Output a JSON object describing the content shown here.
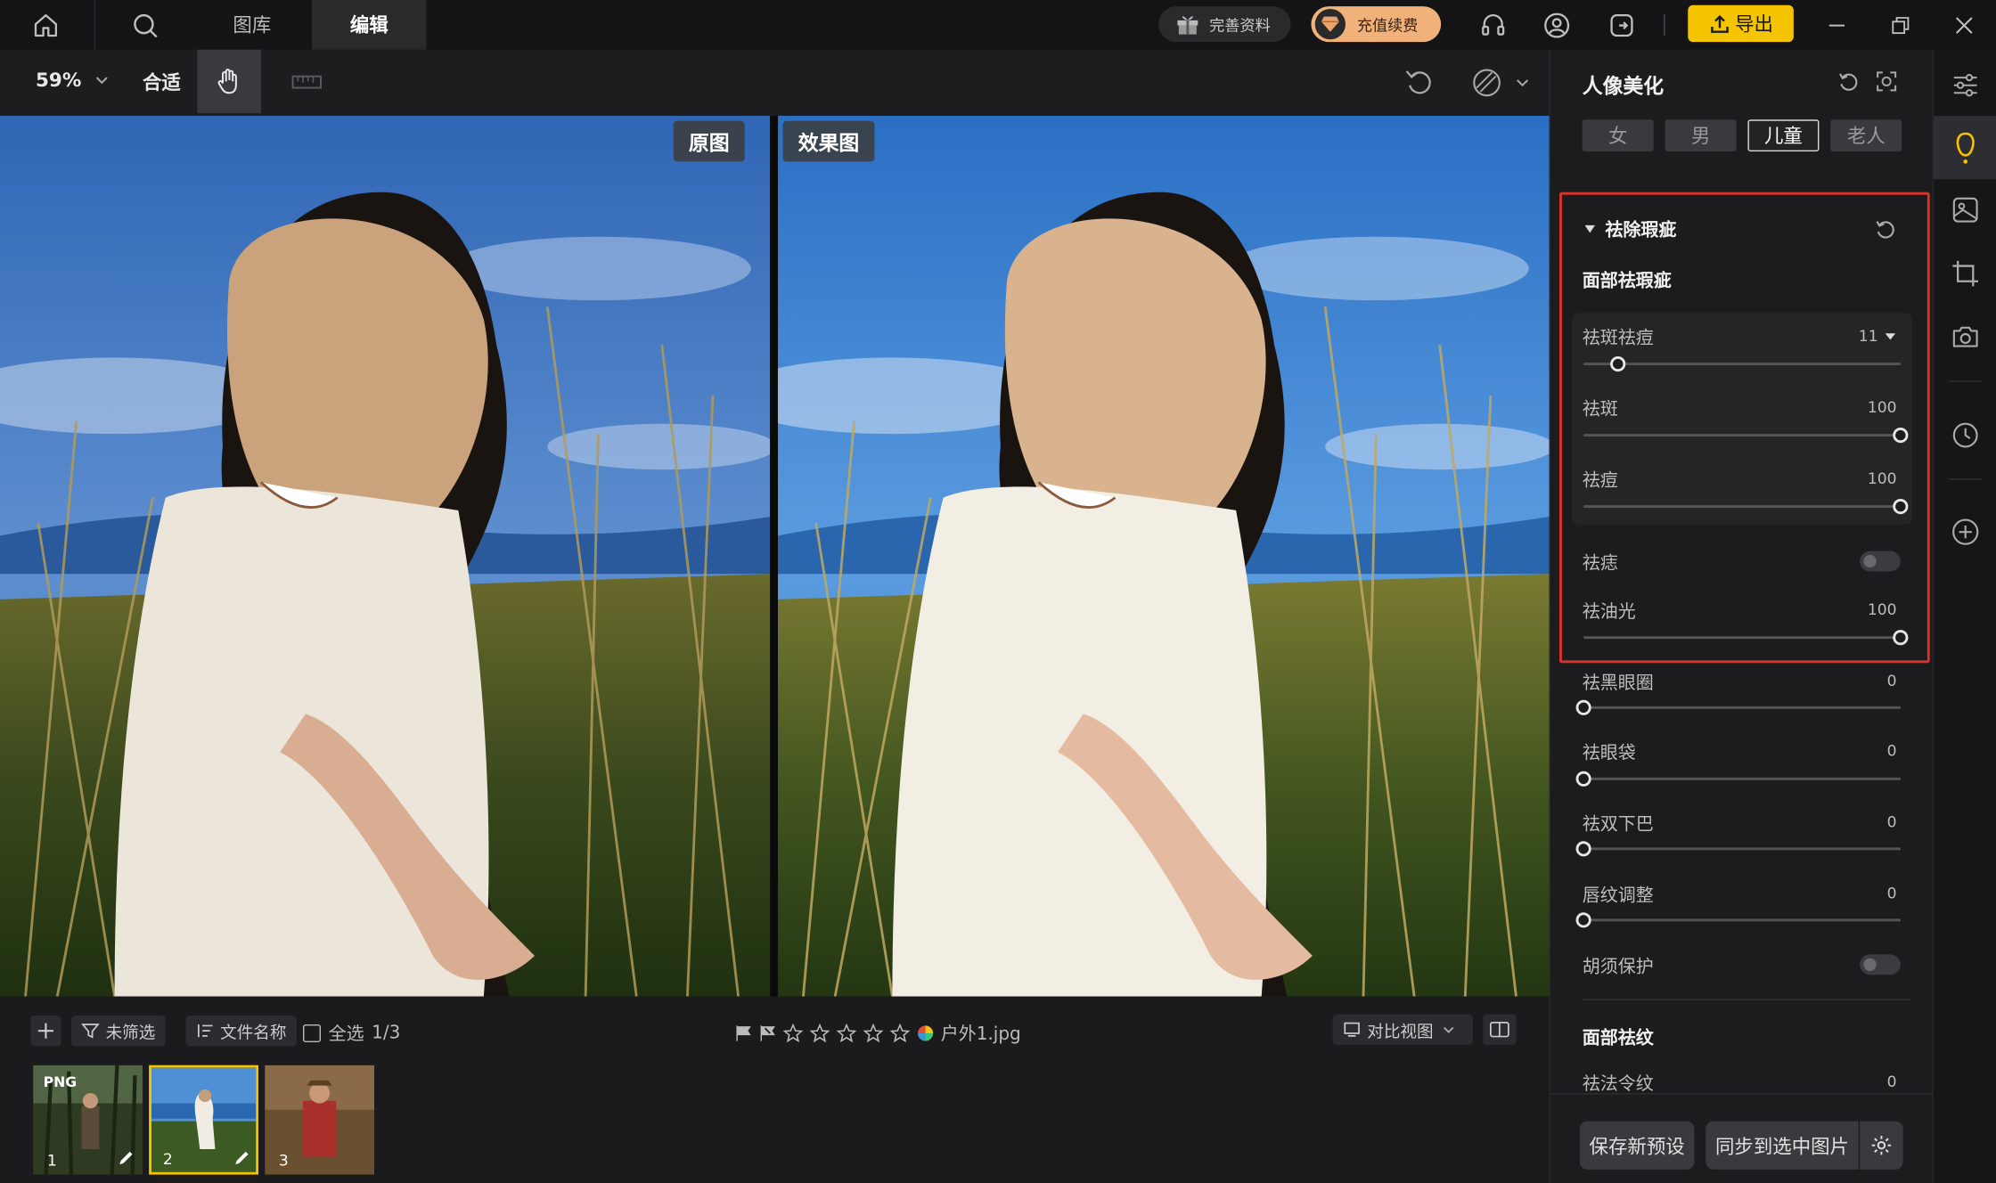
{
  "topbar": {
    "tabs": [
      "图库",
      "编辑"
    ],
    "profile_btn": "完善资料",
    "recharge_btn": "充值续费",
    "export_btn": "导出"
  },
  "toolbar": {
    "zoom": "59%",
    "fit": "合适"
  },
  "preview": {
    "original_label": "原图",
    "effect_label": "效果图"
  },
  "bottom": {
    "filter": "未筛选",
    "sort": "文件名称",
    "select_all": "全选",
    "count": "1/3",
    "filename": "户外1.jpg",
    "view_mode": "对比视图",
    "thumbs": [
      {
        "num": "1",
        "badge": "PNG"
      },
      {
        "num": "2",
        "badge": ""
      },
      {
        "num": "3",
        "badge": ""
      }
    ]
  },
  "panel": {
    "title": "人像美化",
    "segments": [
      "女",
      "男",
      "儿童",
      "老人"
    ],
    "active_segment": "儿童",
    "section": "祛除瑕疵",
    "subsection": "面部祛瑕疵",
    "sliders": {
      "spot_acne": {
        "label": "祛斑祛痘",
        "value": "11",
        "fraction": 0.11
      },
      "spot": {
        "label": "祛斑",
        "value": "100",
        "fraction": 1.0
      },
      "acne": {
        "label": "祛痘",
        "value": "100",
        "fraction": 1.0
      },
      "oil": {
        "label": "祛油光",
        "value": "100",
        "fraction": 1.0
      },
      "dark_circle": {
        "label": "祛黑眼圈",
        "value": "0",
        "fraction": 0
      },
      "eye_bag": {
        "label": "祛眼袋",
        "value": "0",
        "fraction": 0
      },
      "double_chin": {
        "label": "祛双下巴",
        "value": "0",
        "fraction": 0
      },
      "lip_line": {
        "label": "唇纹调整",
        "value": "0",
        "fraction": 0
      },
      "nasolabial": {
        "label": "祛法令纹",
        "value": "0",
        "fraction": 0
      }
    },
    "mole": {
      "label": "祛痣",
      "on": false
    },
    "beard": {
      "label": "胡须保护",
      "on": false
    },
    "wrinkle_section": "面部祛纹",
    "save_preset": "保存新预设",
    "sync": "同步到选中图片"
  },
  "colors": {
    "accent_yellow": "#f5c400",
    "highlight_red": "#e0302c",
    "recharge_orange": "#f0b27a"
  }
}
